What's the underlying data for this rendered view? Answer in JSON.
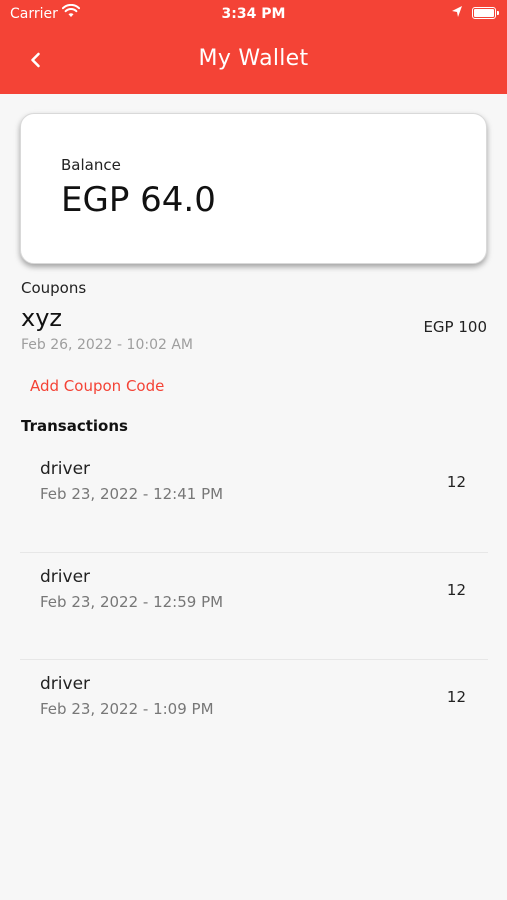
{
  "status_bar": {
    "carrier": "Carrier",
    "time": "3:34 PM",
    "battery_level": 1.0
  },
  "header": {
    "title": "My Wallet",
    "back_icon": "chevron-left-icon"
  },
  "balance": {
    "label": "Balance",
    "value": "EGP 64.0"
  },
  "coupons": {
    "label": "Coupons",
    "items": [
      {
        "code": "xyz",
        "date": "Feb 26, 2022 - 10:02 AM",
        "amount": "EGP 100"
      }
    ],
    "add_label": "Add Coupon Code"
  },
  "transactions": {
    "label": "Transactions",
    "items": [
      {
        "name": "driver",
        "date": "Feb 23, 2022 - 12:41 PM",
        "amount": "12"
      },
      {
        "name": "driver",
        "date": "Feb 23, 2022 - 12:59 PM",
        "amount": "12"
      },
      {
        "name": "driver",
        "date": "Feb 23, 2022 - 1:09 PM",
        "amount": "12"
      }
    ]
  },
  "colors": {
    "accent": "#f44336",
    "background": "#f7f7f7"
  }
}
